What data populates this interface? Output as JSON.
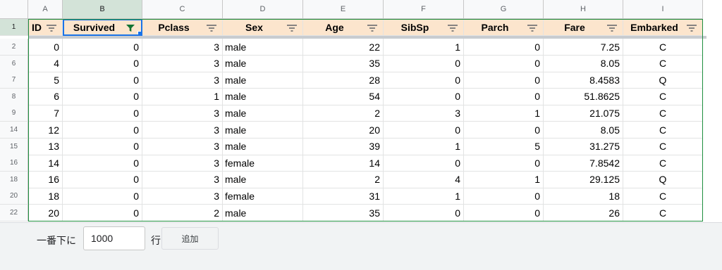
{
  "sheet": {
    "column_letters": [
      "A",
      "B",
      "C",
      "D",
      "E",
      "F",
      "G",
      "H",
      "I"
    ],
    "header_row_number": "1",
    "headers": [
      "ID",
      "Survived",
      "Pclass",
      "Sex",
      "Age",
      "SibSp",
      "Parch",
      "Fare",
      "Embarked"
    ],
    "active_filter_column": "Survived",
    "rows": [
      {
        "num": "2",
        "cells": [
          "0",
          "0",
          "3",
          "male",
          "22",
          "1",
          "0",
          "7.25",
          "C"
        ]
      },
      {
        "num": "6",
        "cells": [
          "4",
          "0",
          "3",
          "male",
          "35",
          "0",
          "0",
          "8.05",
          "C"
        ]
      },
      {
        "num": "7",
        "cells": [
          "5",
          "0",
          "3",
          "male",
          "28",
          "0",
          "0",
          "8.4583",
          "Q"
        ]
      },
      {
        "num": "8",
        "cells": [
          "6",
          "0",
          "1",
          "male",
          "54",
          "0",
          "0",
          "51.8625",
          "C"
        ]
      },
      {
        "num": "9",
        "cells": [
          "7",
          "0",
          "3",
          "male",
          "2",
          "3",
          "1",
          "21.075",
          "C"
        ]
      },
      {
        "num": "14",
        "cells": [
          "12",
          "0",
          "3",
          "male",
          "20",
          "0",
          "0",
          "8.05",
          "C"
        ]
      },
      {
        "num": "15",
        "cells": [
          "13",
          "0",
          "3",
          "male",
          "39",
          "1",
          "5",
          "31.275",
          "C"
        ]
      },
      {
        "num": "16",
        "cells": [
          "14",
          "0",
          "3",
          "female",
          "14",
          "0",
          "0",
          "7.8542",
          "C"
        ]
      },
      {
        "num": "18",
        "cells": [
          "16",
          "0",
          "3",
          "male",
          "2",
          "4",
          "1",
          "29.125",
          "Q"
        ]
      },
      {
        "num": "20",
        "cells": [
          "18",
          "0",
          "3",
          "female",
          "31",
          "1",
          "0",
          "18",
          "C"
        ]
      },
      {
        "num": "22",
        "cells": [
          "20",
          "0",
          "2",
          "male",
          "35",
          "0",
          "0",
          "26",
          "C"
        ]
      }
    ]
  },
  "footer": {
    "label": "一番下に",
    "rows_value": "1000",
    "suffix": "行",
    "add_button": "追加"
  },
  "colors": {
    "header_fill": "#fce5cd",
    "selected_header": "#d3e3d8",
    "frame_green": "#1e8e3e",
    "active_blue": "#1a73e8"
  },
  "icons": {
    "filter": "filter-icon",
    "filter_active": "filter-active-icon"
  }
}
